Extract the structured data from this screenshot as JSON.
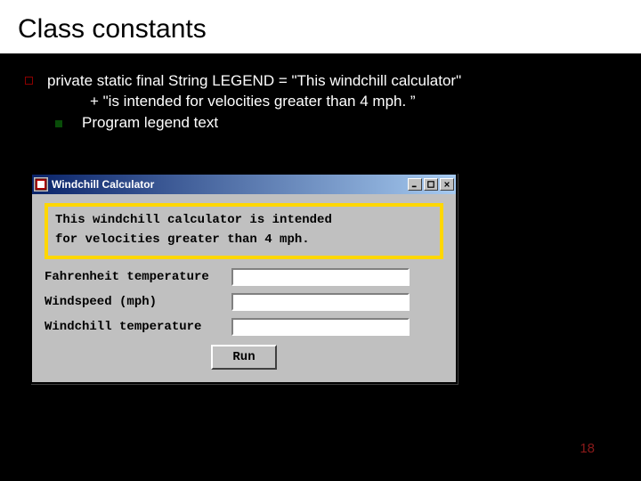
{
  "title": "Class constants",
  "bullets": {
    "code_line1": "private static final String LEGEND = \"This windchill calculator\"",
    "code_line2": "+ \"is intended for velocities greater than 4 mph. ”",
    "sub": "Program legend text"
  },
  "window": {
    "title": "Windchill Calculator",
    "legend_line1": "This windchill calculator is intended",
    "legend_line2": "for velocities greater than 4 mph.",
    "labels": {
      "fahrenheit": "Fahrenheit temperature",
      "windspeed": "Windspeed (mph)",
      "windchill": "Windchill temperature"
    },
    "run": "Run"
  },
  "page_number": "18"
}
